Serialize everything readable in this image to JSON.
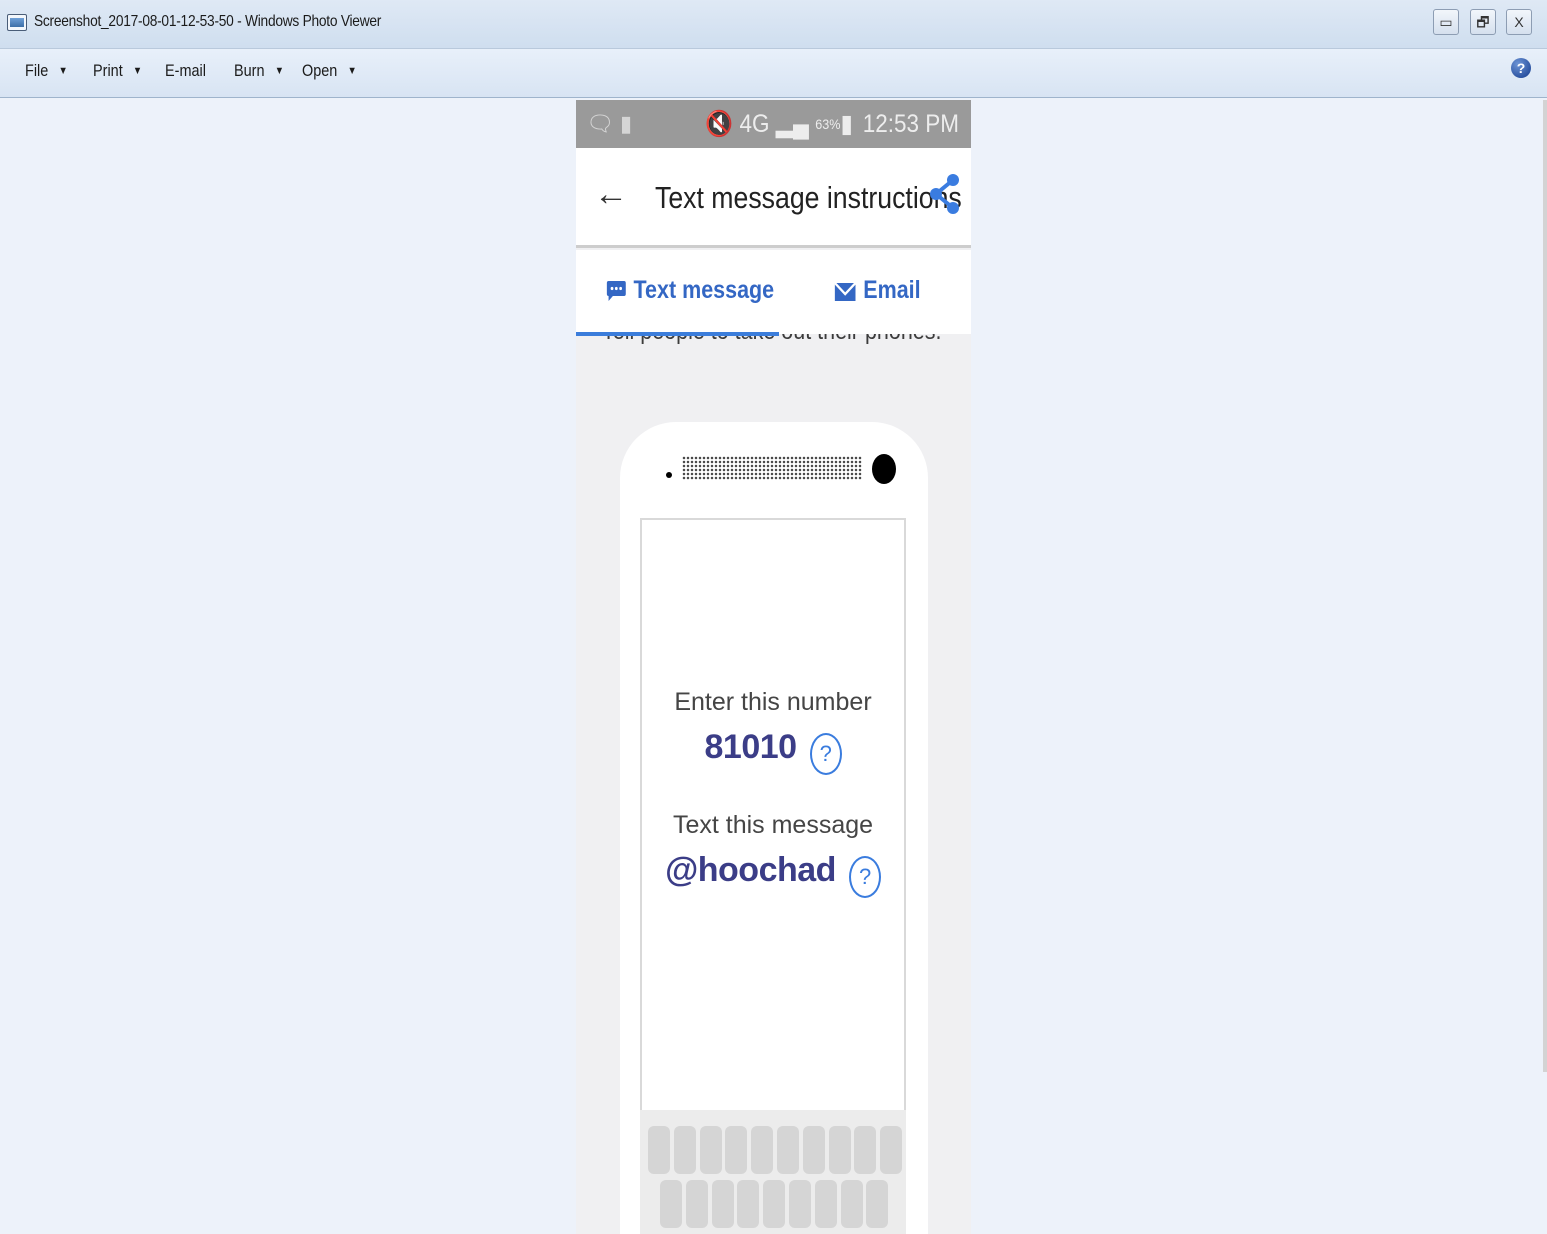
{
  "window": {
    "title": "Screenshot_2017-08-01-12-53-50 - Windows Photo Viewer",
    "controls": {
      "minimize": "▭",
      "restore": "🗗",
      "close": "X"
    }
  },
  "menubar": {
    "items": [
      {
        "label": "File",
        "has_dropdown": true
      },
      {
        "label": "Print",
        "has_dropdown": true
      },
      {
        "label": "E-mail",
        "has_dropdown": false
      },
      {
        "label": "Burn",
        "has_dropdown": true
      },
      {
        "label": "Open",
        "has_dropdown": true
      }
    ],
    "caret": "▼",
    "help_icon": "?"
  },
  "phone_screenshot": {
    "status_bar": {
      "left_icons": "🗨 ▮",
      "signal": "🔇 4G ▂▄",
      "battery": "63%",
      "battery_glyph": "▮",
      "time": "12:53 PM"
    },
    "app_bar": {
      "back_icon": "←",
      "title": "Text message instructions",
      "share_icon": "share-icon"
    },
    "tabs": [
      {
        "label": "Text message",
        "icon": "chat-bubble-icon",
        "selected": true
      },
      {
        "label": "Email",
        "icon": "envelope-icon",
        "selected": false
      }
    ],
    "clipped_body_text": "Tell people to take out their phones.",
    "phone_illustration": {
      "enter_number_label": "Enter this number",
      "number": "81010",
      "text_message_label": "Text this message",
      "message": "@hoochad",
      "help_glyph": "?"
    }
  },
  "colors": {
    "accent_blue": "#3467c4",
    "value_text": "#3b3d87",
    "viewer_background": "#edf2fa",
    "status_bar": "#9a9a9a"
  }
}
